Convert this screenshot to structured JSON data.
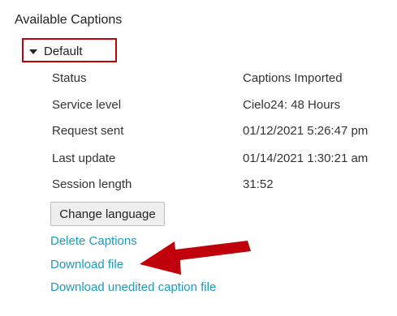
{
  "section": {
    "heading": "Available Captions",
    "toggle_label": "Default"
  },
  "details": [
    {
      "label": "Status",
      "value": "Captions Imported"
    },
    {
      "label": "Service level",
      "value": "Cielo24: 48 Hours"
    },
    {
      "label": "Request sent",
      "value": "01/12/2021 5:26:47 pm"
    },
    {
      "label": "Last update",
      "value": "01/14/2021 1:30:21 am"
    },
    {
      "label": "Session length",
      "value": "31:52"
    }
  ],
  "actions": {
    "change_language": "Change language",
    "delete_captions": "Delete Captions",
    "download_file": "Download file",
    "download_unedited": "Download unedited caption file"
  },
  "annotation": {
    "highlight_color": "#c0000a",
    "arrow_color": "#c0000a"
  },
  "colors": {
    "link": "#1a9bc0",
    "text": "#222222"
  }
}
